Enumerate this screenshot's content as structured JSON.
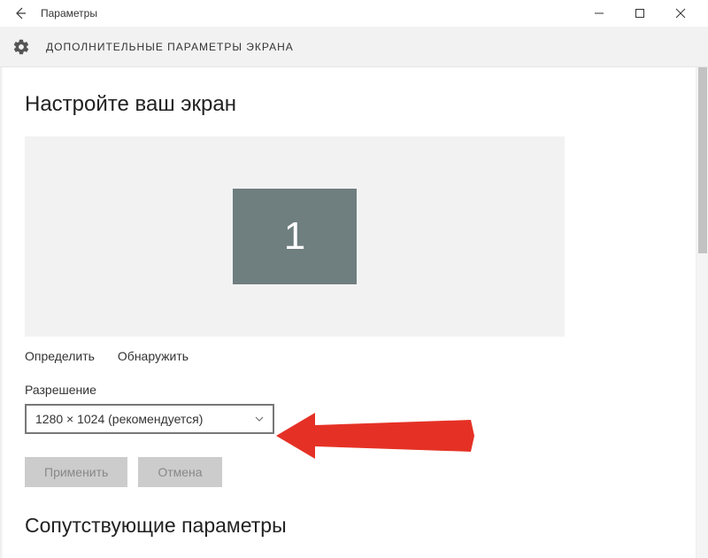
{
  "titlebar": {
    "title": "Параметры"
  },
  "header": {
    "page_title": "ДОПОЛНИТЕЛЬНЫЕ ПАРАМЕТРЫ ЭКРАНА"
  },
  "main": {
    "heading": "Настройте ваш экран",
    "monitor_number": "1",
    "links": {
      "detect": "Определить",
      "discover": "Обнаружить"
    },
    "resolution": {
      "label": "Разрешение",
      "value": "1280 × 1024 (рекомендуется)"
    },
    "buttons": {
      "apply": "Применить",
      "cancel": "Отмена"
    },
    "related_heading": "Сопутствующие параметры"
  }
}
